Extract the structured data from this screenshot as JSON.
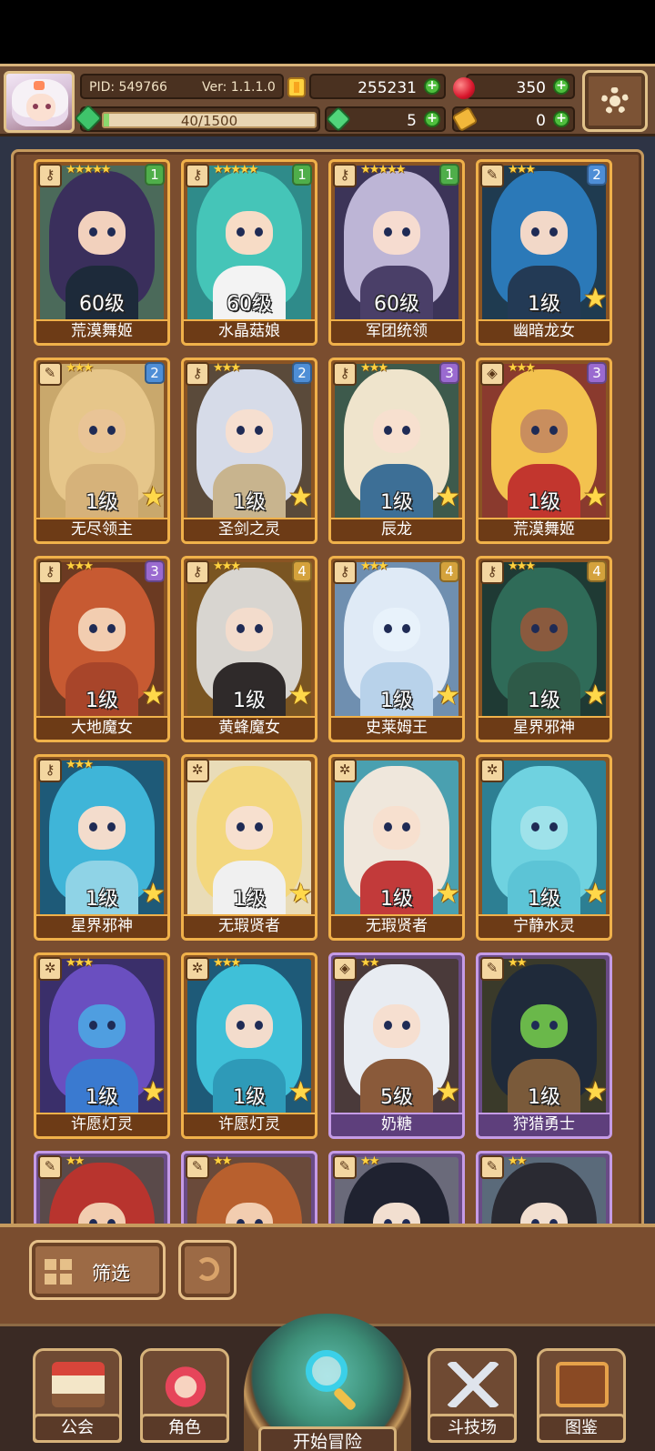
{
  "header": {
    "pid": "PID: 549766",
    "version": "Ver: 1.1.1.0",
    "gold": "255231",
    "gems": "350",
    "exp": "40/1500",
    "exp_fraction": 0.027,
    "clover": "5",
    "tickets": "0"
  },
  "cards": [
    {
      "name": "荒漠舞姬",
      "level": "60级",
      "stars": "★★★★★",
      "rank": "1",
      "rank_class": "rank-1",
      "frame": "gold",
      "type_icon": "key",
      "type_glyph": "⚷",
      "hair": "#3a2f5c",
      "skin": "#f2d1bd",
      "body": "#1d2a3a",
      "bg": "#4b6a5a",
      "show_star": false
    },
    {
      "name": "水晶菇娘",
      "level": "60级",
      "stars": "★★★★★",
      "rank": "1",
      "rank_class": "rank-1",
      "frame": "gold",
      "type_icon": "key",
      "type_glyph": "⚷",
      "hair": "#45c5b8",
      "skin": "#f7dcc6",
      "body": "#f3f3f3",
      "bg": "#2f8b8a",
      "show_star": false
    },
    {
      "name": "军团统领",
      "level": "60级",
      "stars": "★★★★★",
      "rank": "1",
      "rank_class": "rank-1",
      "frame": "gold",
      "type_icon": "key",
      "type_glyph": "⚷",
      "hair": "#bdb5d6",
      "skin": "#f6dcd0",
      "body": "#4a3f68",
      "bg": "#3c3458",
      "show_star": false
    },
    {
      "name": "幽暗龙女",
      "level": "1级",
      "stars": "★★★",
      "rank": "2",
      "rank_class": "rank-2",
      "frame": "gold",
      "type_icon": "feather",
      "type_glyph": "✎",
      "hair": "#2b79b8",
      "skin": "#f2d8c8",
      "body": "#233a55",
      "bg": "#1f3b50",
      "show_star": true
    },
    {
      "name": "无尽领主",
      "level": "1级",
      "stars": "★★★",
      "rank": "2",
      "rank_class": "rank-2",
      "frame": "gold",
      "type_icon": "feather",
      "type_glyph": "✎",
      "hair": "#e6c68a",
      "skin": "#e9c496",
      "body": "#d6b27a",
      "bg": "#c9a86c",
      "show_star": true
    },
    {
      "name": "圣剑之灵",
      "level": "1级",
      "stars": "★★★",
      "rank": "2",
      "rank_class": "rank-2",
      "frame": "gold",
      "type_icon": "key",
      "type_glyph": "⚷",
      "hair": "#d6dbe8",
      "skin": "#f6dfd0",
      "body": "#c8b48e",
      "bg": "#5a4a3a",
      "show_star": true
    },
    {
      "name": "辰龙",
      "level": "1级",
      "stars": "★★★",
      "rank": "3",
      "rank_class": "rank-3",
      "frame": "gold",
      "type_icon": "key",
      "type_glyph": "⚷",
      "hair": "#efe4cc",
      "skin": "#f7e0cf",
      "body": "#3d6f96",
      "bg": "#3d5a4c",
      "show_star": true
    },
    {
      "name": "荒漠舞姬",
      "level": "1级",
      "stars": "★★★",
      "rank": "3",
      "rank_class": "rank-3",
      "frame": "gold",
      "type_icon": "shield",
      "type_glyph": "◈",
      "hair": "#f3c24f",
      "skin": "#c98e5e",
      "body": "#c2362e",
      "bg": "#8a3a2e",
      "show_star": true
    },
    {
      "name": "大地魔女",
      "level": "1级",
      "stars": "★★★",
      "rank": "3",
      "rank_class": "rank-3",
      "frame": "gold",
      "type_icon": "key",
      "type_glyph": "⚷",
      "hair": "#c75a32",
      "skin": "#f2cdb0",
      "body": "#a8452a",
      "bg": "#6b3a22",
      "show_star": true
    },
    {
      "name": "黄蜂魔女",
      "level": "1级",
      "stars": "★★★",
      "rank": "4",
      "rank_class": "rank-4",
      "frame": "gold",
      "type_icon": "key",
      "type_glyph": "⚷",
      "hair": "#d8d5d0",
      "skin": "#f3dccc",
      "body": "#2f2a2a",
      "bg": "#7a5522",
      "show_star": true
    },
    {
      "name": "史莱姆王",
      "level": "1级",
      "stars": "★★★",
      "rank": "4",
      "rank_class": "rank-4",
      "frame": "gold",
      "type_icon": "key",
      "type_glyph": "⚷",
      "hair": "#dfeaf6",
      "skin": "#e8f2fb",
      "body": "#b8d2ea",
      "bg": "#6f8fb0",
      "show_star": true
    },
    {
      "name": "星界邪神",
      "level": "1级",
      "stars": "★★★",
      "rank": "4",
      "rank_class": "rank-4",
      "frame": "gold",
      "type_icon": "key",
      "type_glyph": "⚷",
      "hair": "#2f6b58",
      "skin": "#8a5a3e",
      "body": "#2e5a48",
      "bg": "#1f3a34",
      "show_star": true
    },
    {
      "name": "星界邪神",
      "level": "1级",
      "stars": "★★★",
      "rank": "",
      "rank_class": "rank-2",
      "frame": "gold",
      "type_icon": "key",
      "type_glyph": "⚷",
      "hair": "#3fb5d8",
      "skin": "#f3dccc",
      "body": "#8fd3e6",
      "bg": "#1e5a78",
      "show_star": true
    },
    {
      "name": "无瑕贤者",
      "level": "1级",
      "stars": "",
      "rank": "",
      "rank_class": "rank-4",
      "frame": "gold",
      "type_icon": "compass",
      "type_glyph": "✲",
      "hair": "#f3d77e",
      "skin": "#f7e0cf",
      "body": "#f0f0f0",
      "bg": "#e9dcb8",
      "show_star": true
    },
    {
      "name": "无瑕贤者",
      "level": "1级",
      "stars": "",
      "rank": "",
      "rank_class": "rank-4",
      "frame": "gold",
      "type_icon": "compass",
      "type_glyph": "✲",
      "hair": "#efe7dc",
      "skin": "#f7e0cf",
      "body": "#c23a3a",
      "bg": "#4aa0b0",
      "show_star": true
    },
    {
      "name": "宁静水灵",
      "level": "1级",
      "stars": "",
      "rank": "",
      "rank_class": "rank-4",
      "frame": "gold",
      "type_icon": "compass",
      "type_glyph": "✲",
      "hair": "#6fd2e0",
      "skin": "#9fe2ea",
      "body": "#5cc4d6",
      "bg": "#2d7f93",
      "show_star": true
    },
    {
      "name": "许愿灯灵",
      "level": "1级",
      "stars": "★★★",
      "rank": "",
      "rank_class": "rank-4",
      "frame": "gold",
      "type_icon": "compass",
      "type_glyph": "✲",
      "hair": "#6a4fc0",
      "skin": "#4f9ee0",
      "body": "#3a7ad0",
      "bg": "#3a2f6a",
      "show_star": true
    },
    {
      "name": "许愿灯灵",
      "level": "1级",
      "stars": "★★★",
      "rank": "",
      "rank_class": "rank-4",
      "frame": "gold",
      "type_icon": "compass",
      "type_glyph": "✲",
      "hair": "#3fc0d8",
      "skin": "#f3dccc",
      "body": "#2e9ab8",
      "bg": "#1e5a78",
      "show_star": true
    },
    {
      "name": "奶糖",
      "level": "5级",
      "stars": "★★",
      "rank": "",
      "rank_class": "rank-4",
      "frame": "purple",
      "type_icon": "shield",
      "type_glyph": "◈",
      "hair": "#e8ecf2",
      "skin": "#f6dfd0",
      "body": "#8a5a3a",
      "bg": "#4a3a3a",
      "show_star": true
    },
    {
      "name": "狩猎勇士",
      "level": "1级",
      "stars": "★★",
      "rank": "",
      "rank_class": "rank-4",
      "frame": "purple",
      "type_icon": "feather",
      "type_glyph": "✎",
      "hair": "#1f2a3a",
      "skin": "#6ab84a",
      "body": "#7a5a3a",
      "bg": "#3a3a2a",
      "show_star": true
    },
    {
      "name": "",
      "level": "",
      "stars": "★★",
      "rank": "",
      "rank_class": "rank-4",
      "frame": "purple",
      "type_icon": "feather",
      "type_glyph": "✎",
      "hair": "#b8342e",
      "skin": "#f2cdb0",
      "body": "#4a2a2a",
      "bg": "#5a4a4a",
      "show_star": false
    },
    {
      "name": "",
      "level": "",
      "stars": "★★",
      "rank": "",
      "rank_class": "rank-4",
      "frame": "purple",
      "type_icon": "feather",
      "type_glyph": "✎",
      "hair": "#b8602e",
      "skin": "#f2cdb0",
      "body": "#4a2a2a",
      "bg": "#6a4a3a",
      "show_star": false
    },
    {
      "name": "",
      "level": "",
      "stars": "★★",
      "rank": "",
      "rank_class": "rank-4",
      "frame": "purple",
      "type_icon": "feather",
      "type_glyph": "✎",
      "hair": "#1f2230",
      "skin": "#f2dfd0",
      "body": "#2a2a30",
      "bg": "#6a6a7a",
      "show_star": false
    },
    {
      "name": "",
      "level": "",
      "stars": "★★",
      "rank": "",
      "rank_class": "rank-4",
      "frame": "purple",
      "type_icon": "feather",
      "type_glyph": "✎",
      "hair": "#2a2a32",
      "skin": "#f2dfd0",
      "body": "#2a2a30",
      "bg": "#5a6a7a",
      "show_star": false
    }
  ],
  "bottom": {
    "filter_label": "筛选"
  },
  "nav": {
    "guild": "公会",
    "characters": "角色",
    "start": "开始冒险",
    "arena": "斗技场",
    "codex": "图鉴"
  }
}
